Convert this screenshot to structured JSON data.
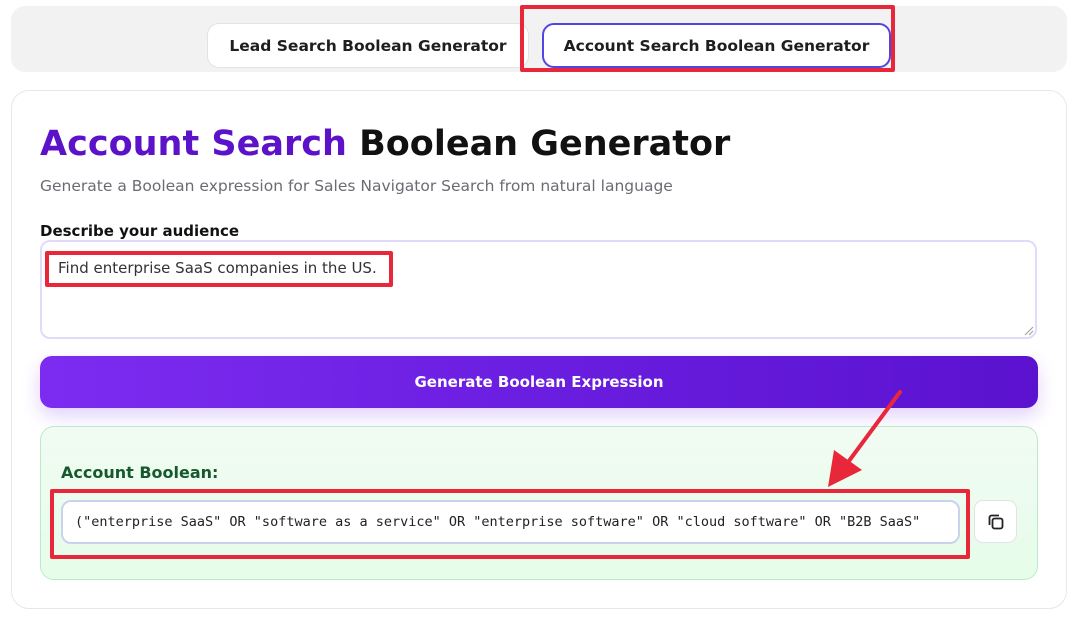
{
  "tabs": {
    "lead_label": "Lead Search Boolean Generator",
    "account_label": "Account Search Boolean Generator",
    "active": "account"
  },
  "header": {
    "title_accent": "Account Search",
    "title_rest": "Boolean Generator",
    "subtitle": "Generate a Boolean expression for Sales Navigator Search from natural language"
  },
  "form": {
    "audience_label": "Describe your audience",
    "audience_value": "Find enterprise SaaS companies in the US."
  },
  "actions": {
    "generate_label": "Generate Boolean Expression"
  },
  "result": {
    "label": "Account Boolean:",
    "value": "(\"enterprise SaaS\" OR \"software as a service\" OR \"enterprise software\" OR \"cloud software\" OR \"B2B SaaS\""
  },
  "icons": {
    "copy": "copy-icon",
    "arrow": "annotation-arrow-icon"
  },
  "colors": {
    "accent": "#5b12c9",
    "highlight": "#e8283a",
    "result_label": "#17592e"
  }
}
